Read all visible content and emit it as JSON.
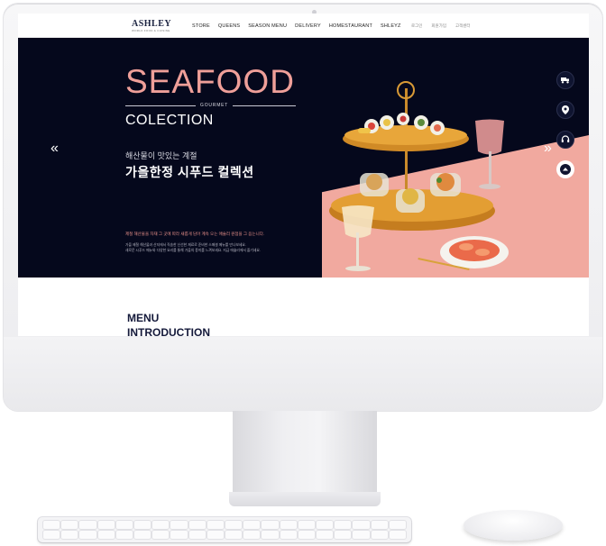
{
  "site": {
    "logo": "ASHLEY",
    "logo_sub": "WORLD FOOD & CUISINE",
    "nav": [
      "STORE",
      "QUEENS",
      "SEASON MENU",
      "DELIVERY",
      "HOMESTAURANT",
      "SHLEYZ"
    ],
    "util_links": [
      "로그인",
      "회원가입",
      "고객센터"
    ]
  },
  "hero": {
    "title": "SEAFOOD",
    "gourmet": "GOURMET",
    "collection": "COLECTION",
    "sub_ko": "해산물이 맛있는 계절",
    "main_ko": "가을한정 시푸드 컬렉션",
    "note_pink": "제철 해산물을 자재 그 곳에 따라 새롭게 담아 계속 오는 애슐리 원점을 그 음는니다.",
    "note_lines": [
      "가을 제철 해산물과 산지에서 직송한 신선한 재료로 준비한 스페셜 메뉴를 만나보세요.",
      "새로운 시푸드 메뉴와 다양한 요리를 통해 가을의 풍미를 느껴보세요. 지금 애슐리에서 즐기세요."
    ],
    "arrow_left": "«",
    "arrow_right": "»"
  },
  "quick_menu": [
    "delivery-truck-icon",
    "location-pin-icon",
    "headset-icon",
    "scroll-top-icon"
  ],
  "section": {
    "title_line1": "MENU",
    "title_line2": "INTRODUCTION"
  },
  "colors": {
    "hero_bg": "#05081c",
    "accent_pink": "#ef9f99",
    "navy": "#14193a"
  }
}
